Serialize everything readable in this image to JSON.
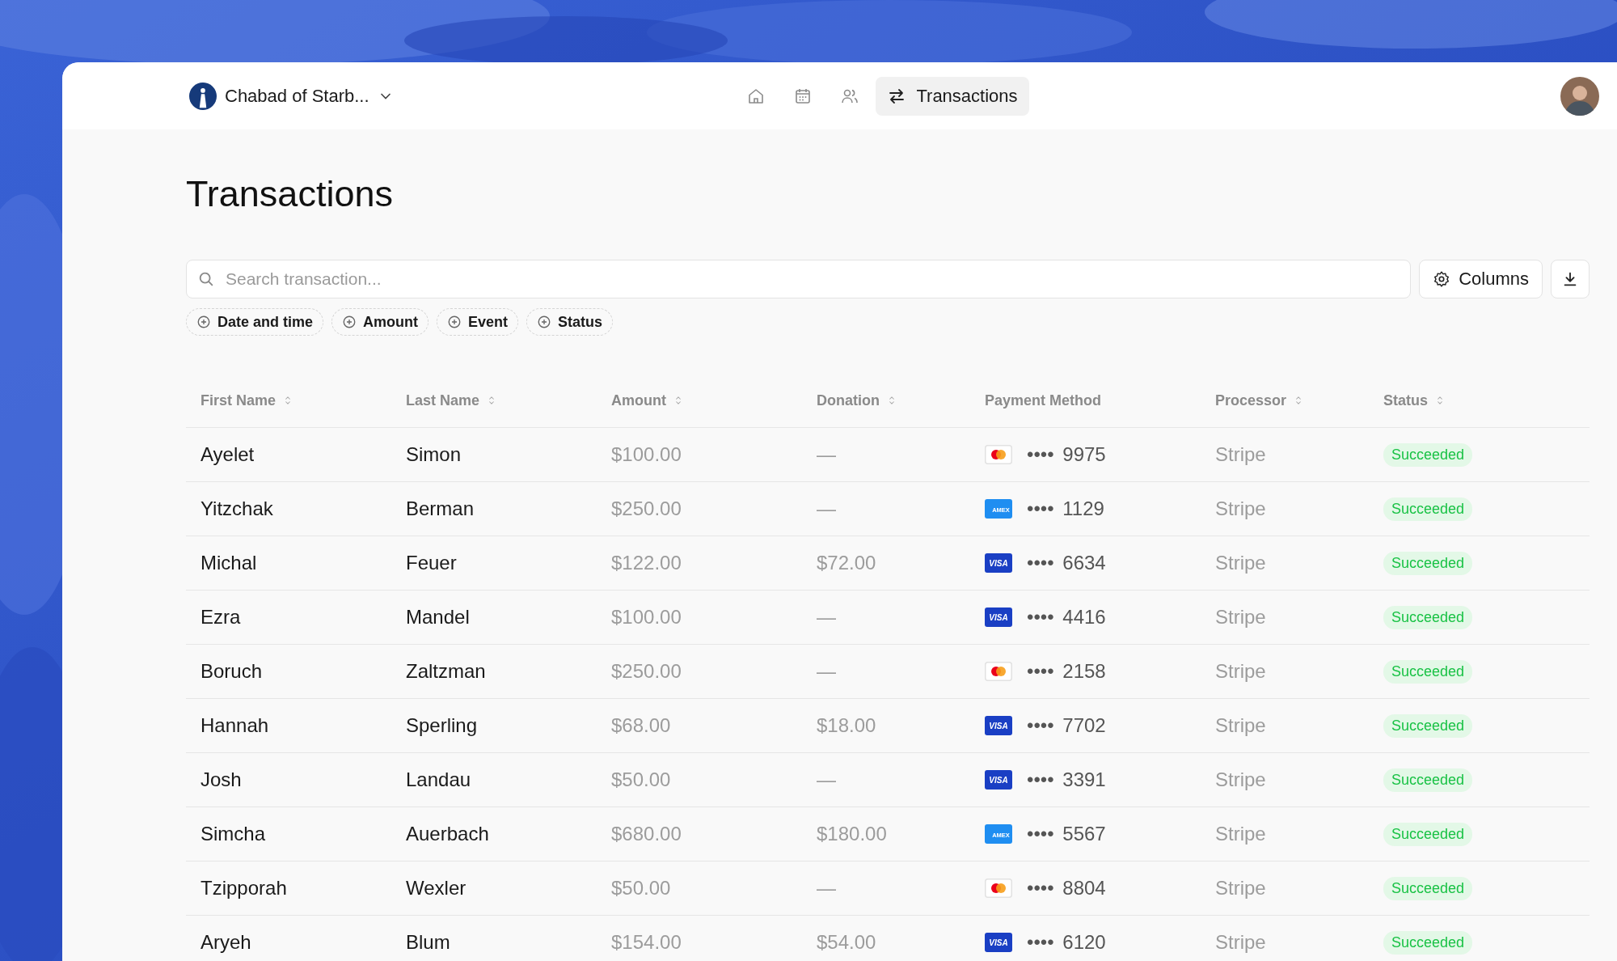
{
  "header": {
    "org_name": "Chabad of Starb...",
    "nav": [
      {
        "kind": "home",
        "selected": false
      },
      {
        "kind": "calendar",
        "selected": false
      },
      {
        "kind": "people",
        "selected": false
      },
      {
        "kind": "transfer",
        "label": "Transactions",
        "selected": true
      }
    ]
  },
  "title": "Transactions",
  "search": {
    "placeholder": "Search transaction..."
  },
  "columns_button": "Columns",
  "filters": [
    "Date and time",
    "Amount",
    "Event",
    "Status"
  ],
  "table": {
    "columns": [
      {
        "label": "First Name",
        "sortable": true
      },
      {
        "label": "Last Name",
        "sortable": true
      },
      {
        "label": "Amount",
        "sortable": true
      },
      {
        "label": "Donation",
        "sortable": true
      },
      {
        "label": "Payment Method",
        "sortable": false
      },
      {
        "label": "Processor",
        "sortable": true
      },
      {
        "label": "Status",
        "sortable": true
      }
    ],
    "rows": [
      {
        "first": "Ayelet",
        "last": "Simon",
        "amount": "$100.00",
        "donation": "—",
        "card": {
          "kind": "mastercard",
          "number": "•••• 9975"
        },
        "processor": "Stripe",
        "status": "Succeeded"
      },
      {
        "first": "Yitzchak",
        "last": "Berman",
        "amount": "$250.00",
        "donation": "—",
        "card": {
          "kind": "amex",
          "logo_text": "AMEX",
          "number": "•••• 1129"
        },
        "processor": "Stripe",
        "status": "Succeeded"
      },
      {
        "first": "Michal",
        "last": "Feuer",
        "amount": "$122.00",
        "donation": "$72.00",
        "card": {
          "kind": "visa",
          "logo_text": "VISA",
          "number": "•••• 6634"
        },
        "processor": "Stripe",
        "status": "Succeeded"
      },
      {
        "first": "Ezra",
        "last": "Mandel",
        "amount": "$100.00",
        "donation": "—",
        "card": {
          "kind": "visa",
          "logo_text": "VISA",
          "number": "•••• 4416"
        },
        "processor": "Stripe",
        "status": "Succeeded"
      },
      {
        "first": "Boruch",
        "last": "Zaltzman",
        "amount": "$250.00",
        "donation": "—",
        "card": {
          "kind": "mastercard",
          "number": "•••• 2158"
        },
        "processor": "Stripe",
        "status": "Succeeded"
      },
      {
        "first": "Hannah",
        "last": "Sperling",
        "amount": "$68.00",
        "donation": "$18.00",
        "card": {
          "kind": "visa",
          "logo_text": "VISA",
          "number": "•••• 7702"
        },
        "processor": "Stripe",
        "status": "Succeeded"
      },
      {
        "first": "Josh",
        "last": "Landau",
        "amount": "$50.00",
        "donation": "—",
        "card": {
          "kind": "visa",
          "logo_text": "VISA",
          "number": "•••• 3391"
        },
        "processor": "Stripe",
        "status": "Succeeded"
      },
      {
        "first": "Simcha",
        "last": "Auerbach",
        "amount": "$680.00",
        "donation": "$180.00",
        "card": {
          "kind": "amex",
          "logo_text": "AMEX",
          "number": "•••• 5567"
        },
        "processor": "Stripe",
        "status": "Succeeded"
      },
      {
        "first": "Tzipporah",
        "last": "Wexler",
        "amount": "$50.00",
        "donation": "—",
        "card": {
          "kind": "mastercard",
          "number": "•••• 8804"
        },
        "processor": "Stripe",
        "status": "Succeeded"
      },
      {
        "first": "Aryeh",
        "last": "Blum",
        "amount": "$154.00",
        "donation": "$54.00",
        "card": {
          "kind": "visa",
          "logo_text": "VISA",
          "number": "•••• 6120"
        },
        "processor": "Stripe",
        "status": "Succeeded"
      }
    ]
  }
}
